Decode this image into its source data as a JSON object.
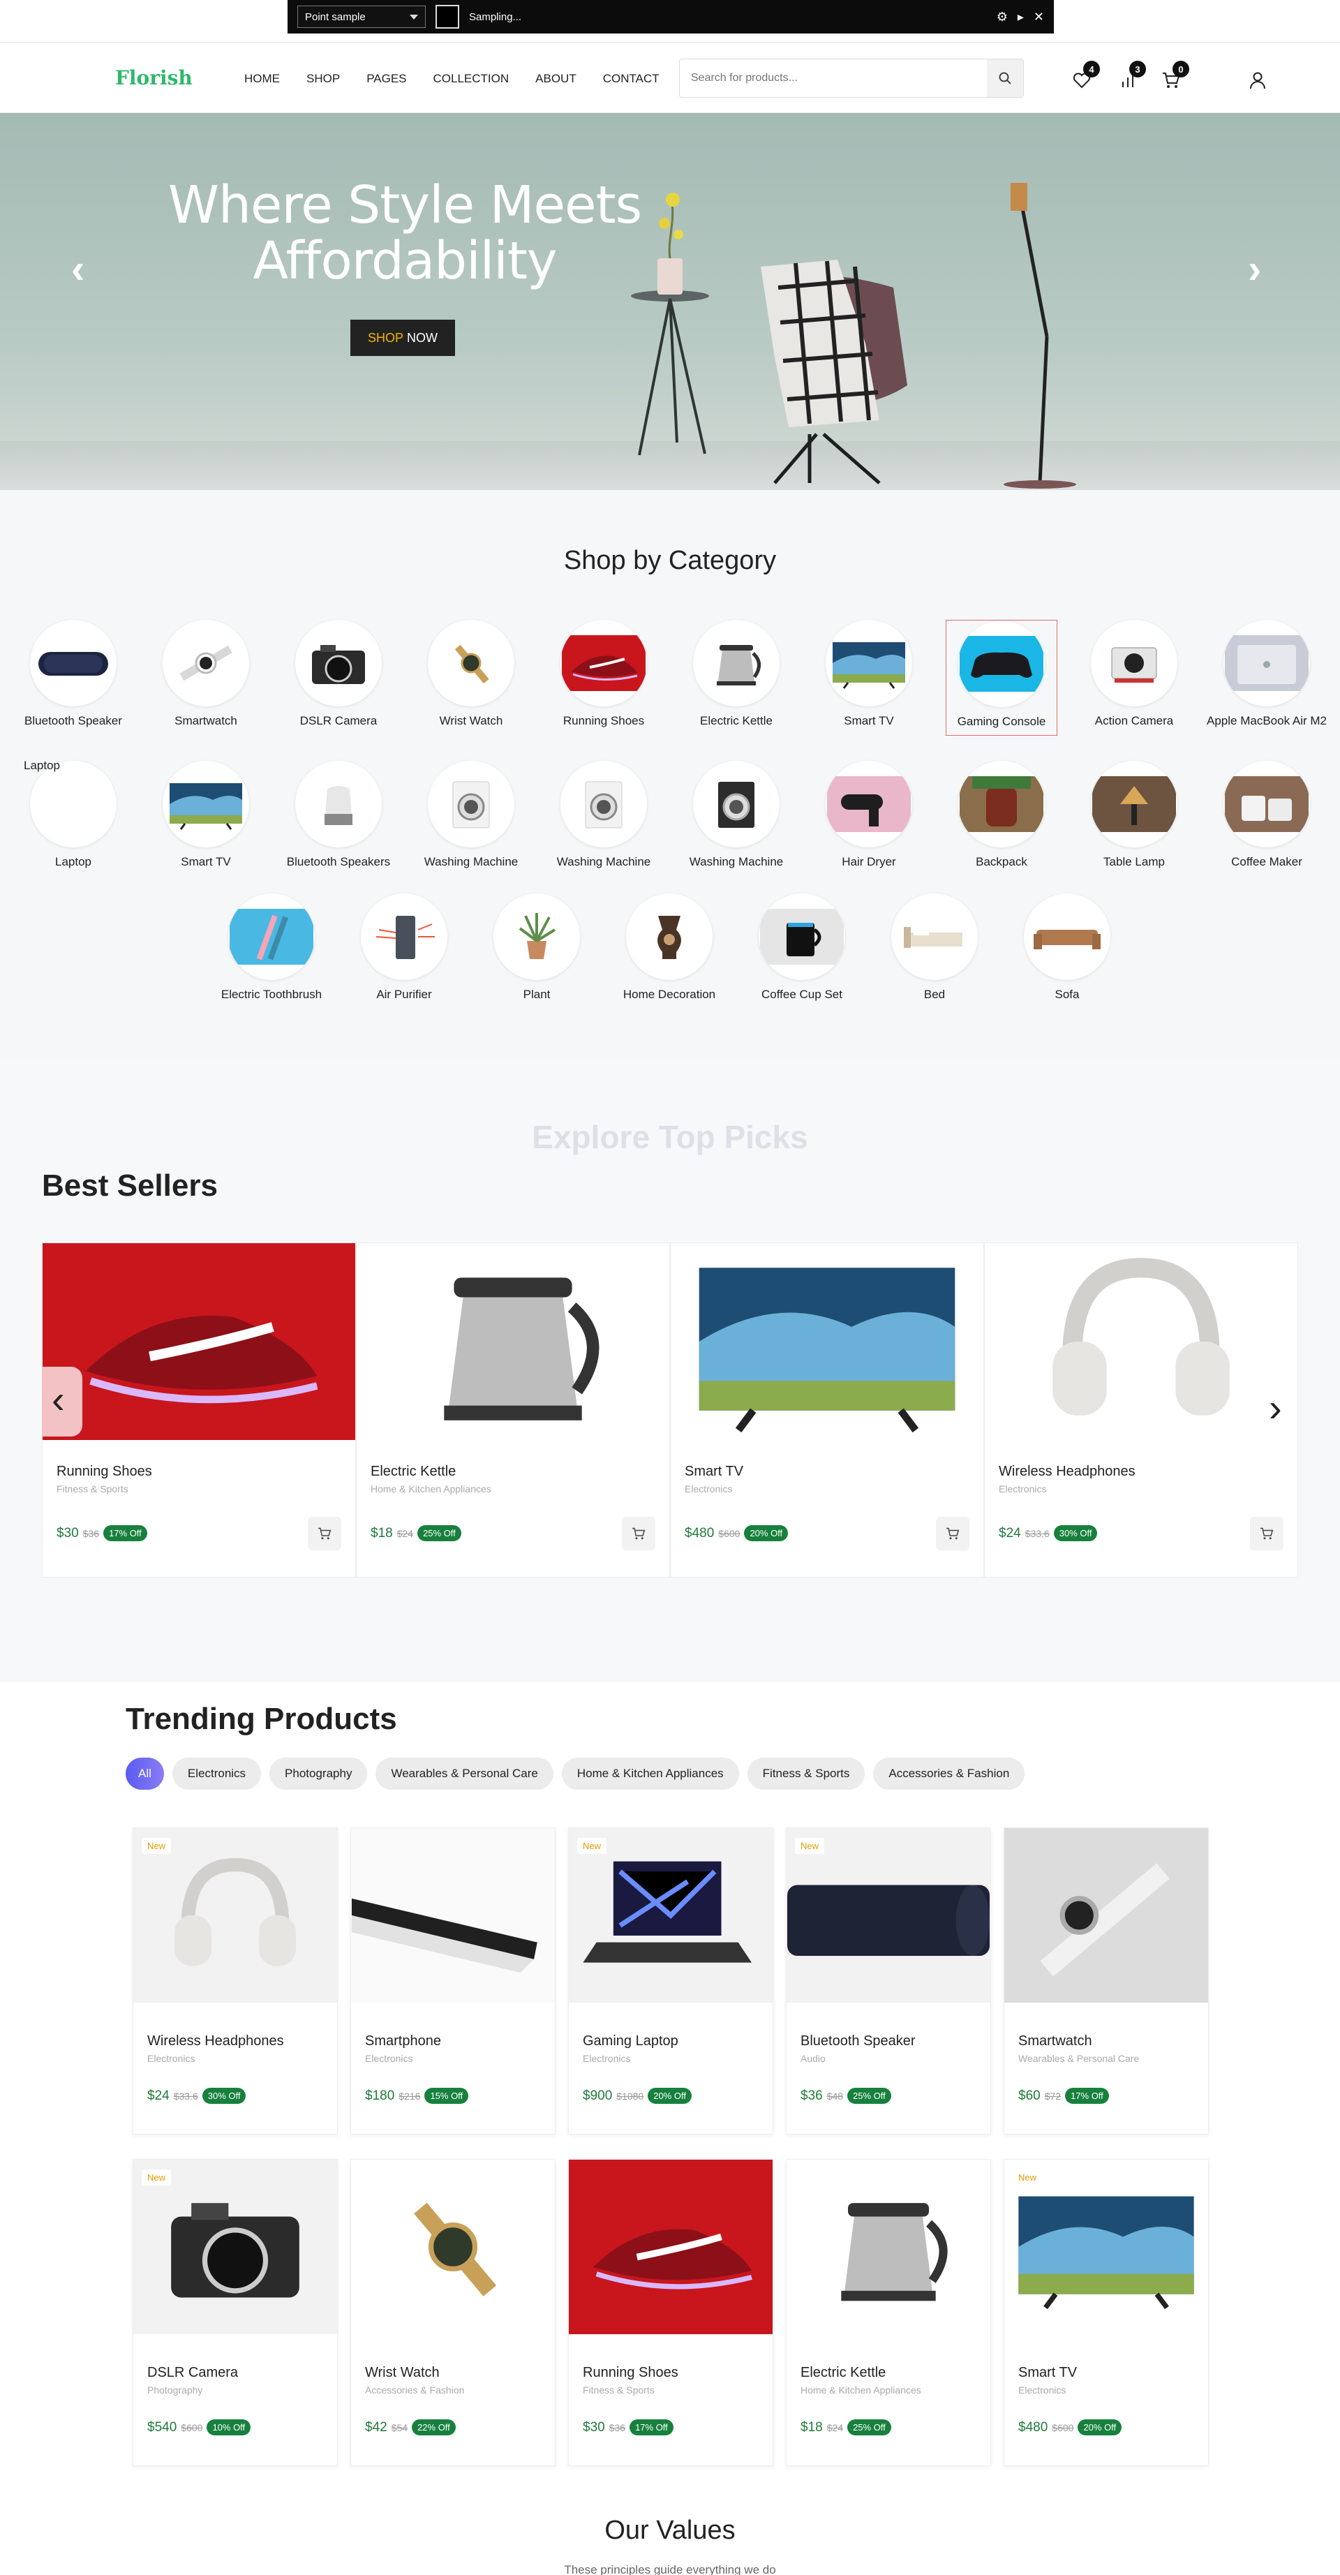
{
  "sampler": {
    "mode": "Point sample",
    "status": "Sampling..."
  },
  "brand": "Florish",
  "nav": [
    "HOME",
    "SHOP",
    "PAGES",
    "COLLECTION",
    "ABOUT",
    "CONTACT"
  ],
  "search": {
    "placeholder": "Search for products..."
  },
  "header_icons": {
    "wishlist_count": "4",
    "compare_count": "3",
    "cart_count": "0"
  },
  "hero": {
    "title": "Where Style Meets Affordability",
    "cta_accent": "SHOP",
    "cta_rest": "NOW",
    "prev": "‹",
    "next": "›"
  },
  "categories": {
    "title": "Shop by Category",
    "items": [
      {
        "label": "Bluetooth Speaker"
      },
      {
        "label": "Smartwatch"
      },
      {
        "label": "DSLR Camera"
      },
      {
        "label": "Wrist Watch"
      },
      {
        "label": "Running Shoes"
      },
      {
        "label": "Electric Kettle"
      },
      {
        "label": "Smart TV"
      },
      {
        "label": "Gaming Console"
      },
      {
        "label": "Action Camera"
      },
      {
        "label": "Apple MacBook Air M2"
      },
      {
        "label": "Laptop",
        "img_alt": "Laptop"
      },
      {
        "label": "Smart TV"
      },
      {
        "label": "Bluetooth Speakers"
      },
      {
        "label": "Washing Machine"
      },
      {
        "label": "Washing Machine"
      },
      {
        "label": "Washing Machine"
      },
      {
        "label": "Hair Dryer"
      },
      {
        "label": "Backpack"
      },
      {
        "label": "Table Lamp"
      },
      {
        "label": "Coffee Maker"
      },
      {
        "label": "Electric Toothbrush"
      },
      {
        "label": "Air Purifier"
      },
      {
        "label": "Plant"
      },
      {
        "label": "Home Decoration"
      },
      {
        "label": "Coffee Cup Set"
      },
      {
        "label": "Bed"
      },
      {
        "label": "Sofa"
      }
    ]
  },
  "best_sellers": {
    "ghost": "Explore Top Picks",
    "title": "Best Sellers",
    "prev": "‹",
    "next": "›",
    "items": [
      {
        "name": "Running Shoes",
        "category": "Fitness & Sports",
        "price": "$30",
        "old": "$36",
        "off": "17% Off"
      },
      {
        "name": "Electric Kettle",
        "category": "Home & Kitchen Appliances",
        "price": "$18",
        "old": "$24",
        "off": "25% Off"
      },
      {
        "name": "Smart TV",
        "category": "Electronics",
        "price": "$480",
        "old": "$600",
        "off": "20% Off"
      },
      {
        "name": "Wireless Headphones",
        "category": "Electronics",
        "price": "$24",
        "old": "$33.6",
        "off": "30% Off"
      }
    ]
  },
  "trending": {
    "title": "Trending Products",
    "tabs": [
      "All",
      "Electronics",
      "Photography",
      "Wearables & Personal Care",
      "Home & Kitchen Appliances",
      "Fitness & Sports",
      "Accessories & Fashion"
    ],
    "new_label": "New",
    "items": [
      {
        "name": "Wireless Headphones",
        "category": "Electronics",
        "price": "$24",
        "old": "$33.6",
        "off": "30% Off"
      },
      {
        "name": "Smartphone",
        "category": "Electronics",
        "price": "$180",
        "old": "$216",
        "off": "15% Off"
      },
      {
        "name": "Gaming Laptop",
        "category": "Electronics",
        "price": "$900",
        "old": "$1080",
        "off": "20% Off"
      },
      {
        "name": "Bluetooth Speaker",
        "category": "Audio",
        "price": "$36",
        "old": "$48",
        "off": "25% Off"
      },
      {
        "name": "Smartwatch",
        "category": "Wearables & Personal Care",
        "price": "$60",
        "old": "$72",
        "off": "17% Off"
      },
      {
        "name": "DSLR Camera",
        "category": "Photography",
        "price": "$540",
        "old": "$600",
        "off": "10% Off"
      },
      {
        "name": "Wrist Watch",
        "category": "Accessories & Fashion",
        "price": "$42",
        "old": "$54",
        "off": "22% Off"
      },
      {
        "name": "Running Shoes",
        "category": "Fitness & Sports",
        "price": "$30",
        "old": "$36",
        "off": "17% Off"
      },
      {
        "name": "Electric Kettle",
        "category": "Home & Kitchen Appliances",
        "price": "$18",
        "old": "$24",
        "off": "25% Off"
      },
      {
        "name": "Smart TV",
        "category": "Electronics",
        "price": "$480",
        "old": "$600",
        "off": "20% Off"
      }
    ]
  },
  "values": {
    "title": "Our Values",
    "subtitle": "These principles guide everything we do"
  }
}
